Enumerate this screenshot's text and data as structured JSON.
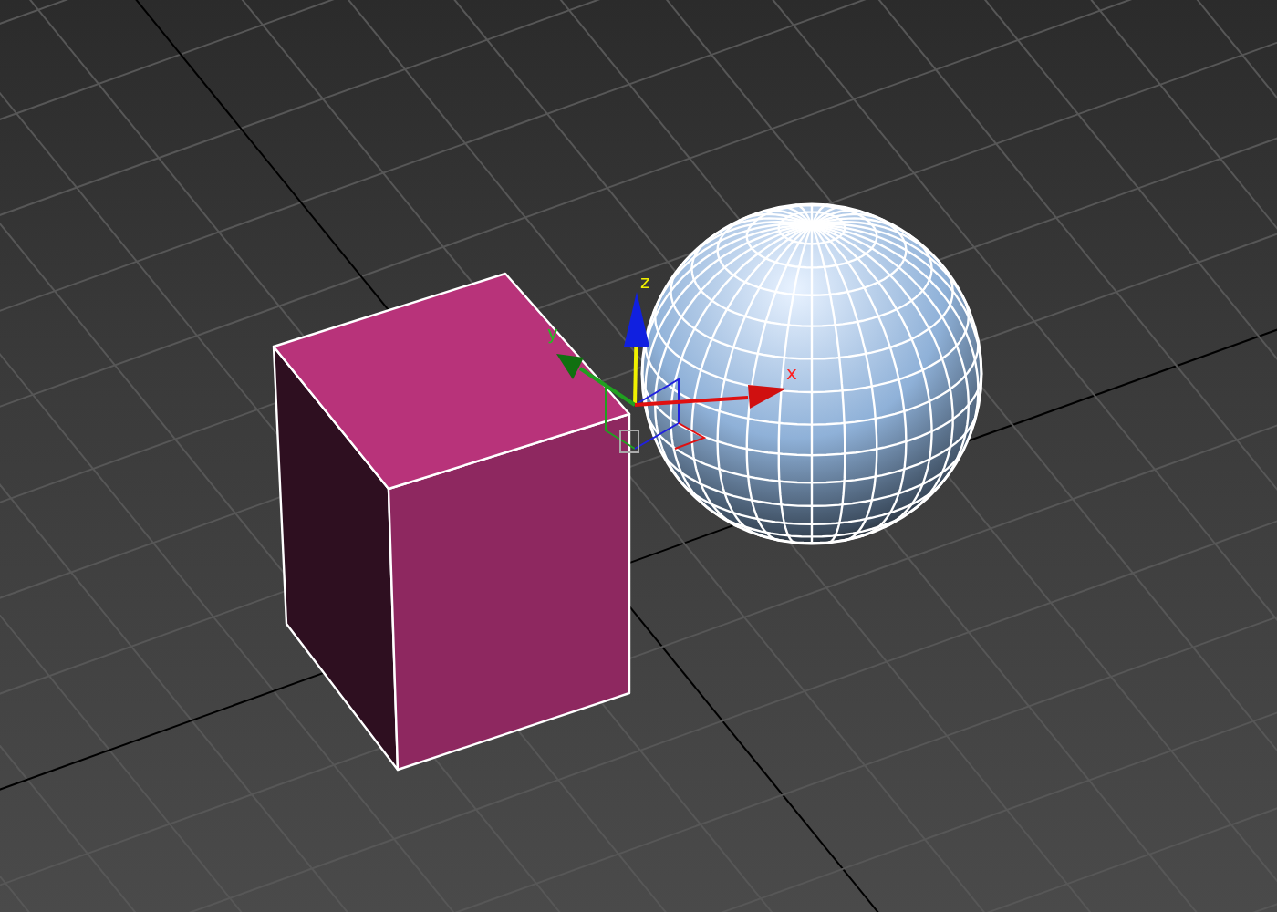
{
  "viewport": {
    "gizmo": {
      "axes": [
        {
          "kind": "z",
          "label": "z",
          "color": "#f0f000"
        },
        {
          "kind": "y",
          "label": "y",
          "color": "#20c020"
        },
        {
          "kind": "x",
          "label": "x",
          "color": "#ff2020"
        }
      ]
    }
  }
}
